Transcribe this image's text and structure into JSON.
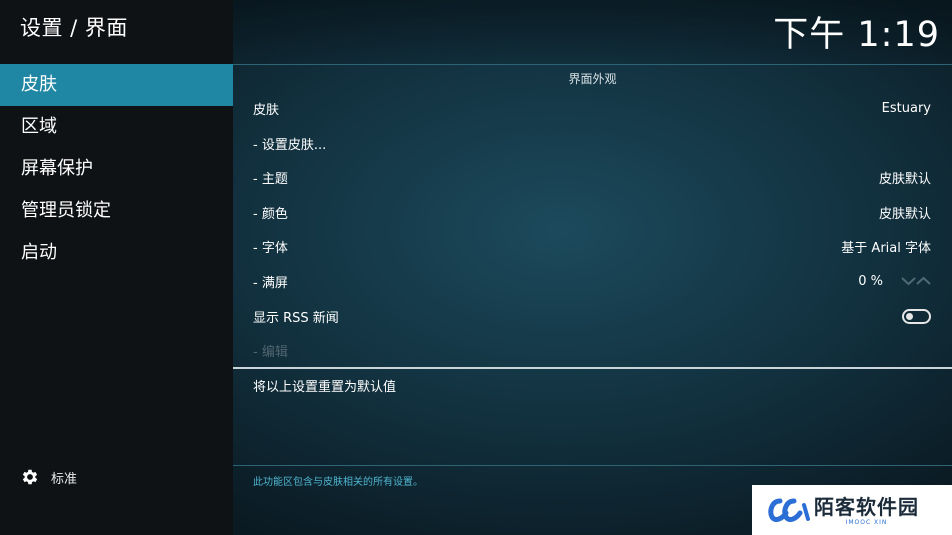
{
  "sidebar": {
    "title": "设置 / 界面",
    "items": [
      {
        "label": "皮肤",
        "active": true
      },
      {
        "label": "区域",
        "active": false
      },
      {
        "label": "屏幕保护",
        "active": false
      },
      {
        "label": "管理员锁定",
        "active": false
      },
      {
        "label": "启动",
        "active": false
      }
    ],
    "footer": {
      "icon": "gear-icon",
      "label": "标准"
    }
  },
  "header": {
    "clock": "下午 1:19"
  },
  "content": {
    "section_title": "界面外观",
    "rows": {
      "skin": {
        "label": "皮肤",
        "value": "Estuary"
      },
      "configure_skin": {
        "label": "- 设置皮肤..."
      },
      "theme": {
        "label": "- 主题",
        "value": "皮肤默认"
      },
      "colors": {
        "label": "- 颜色",
        "value": "皮肤默认"
      },
      "fonts": {
        "label": "- 字体",
        "value": "基于 Arial 字体"
      },
      "zoom": {
        "label": "- 满屏",
        "value": "0 %"
      },
      "rss": {
        "label": "显示 RSS 新闻",
        "enabled": false
      },
      "edit": {
        "label": "- 编辑",
        "disabled": true
      }
    },
    "reset_label": "将以上设置重置为默认值",
    "help_text": "此功能区包含与皮肤相关的所有设置。"
  },
  "watermark": {
    "title": "陌客软件园",
    "subtitle": "IMOOC XIN"
  },
  "colors": {
    "accent": "#1f87a3",
    "sidebar_bg": "#0e1215",
    "help_text": "#4fb6d1",
    "disabled_text": "#51666f"
  }
}
